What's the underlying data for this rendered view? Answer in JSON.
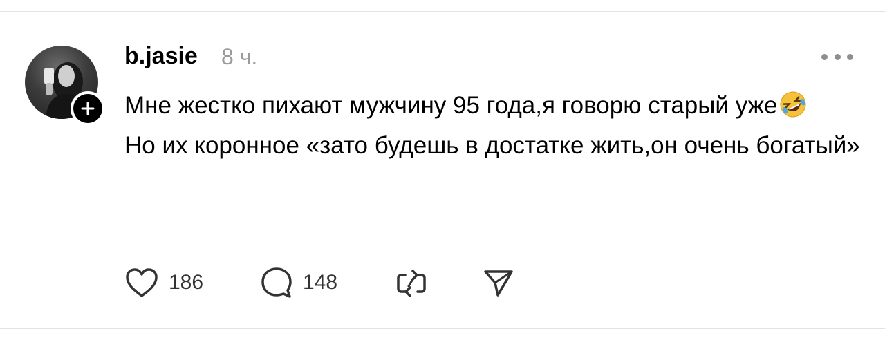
{
  "post": {
    "username": "b.jasie",
    "time": "8 ч.",
    "text_line1": "Мне жестко пихают мужчину 95 года,я говорю старый уже",
    "emoji": "🤣",
    "text_line2": "Но их коронное «зато будешь в достатке жить,он очень богатый»",
    "likes": "186",
    "comments": "148"
  },
  "icons": {
    "avatar": "avatar-photo",
    "follow": "plus-icon",
    "more": "more-icon",
    "like": "heart-icon",
    "comment": "comment-icon",
    "repost": "repost-icon",
    "share": "send-icon"
  },
  "colors": {
    "text": "#000000",
    "muted": "#9a9a9a",
    "divider": "#e3e3e3",
    "emoji": "#f7c23b"
  }
}
